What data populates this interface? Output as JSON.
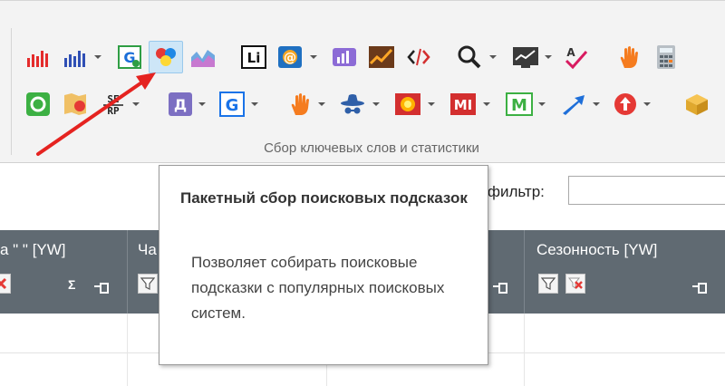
{
  "ribbon": {
    "group_label": "Сбор ключевых слов и статистики",
    "row1": [
      {
        "icon": "bar-chart-red-icon"
      },
      {
        "icon": "bar-chart-blue-icon"
      },
      {
        "icon": "google-stats-icon"
      },
      {
        "icon": "batch-suggestions-icon"
      },
      {
        "icon": "area-chart-icon"
      },
      {
        "icon": "linkedin-icon",
        "text": "Li"
      },
      {
        "icon": "at-sign-icon",
        "text": "@"
      },
      {
        "icon": "purple-chart-icon"
      },
      {
        "icon": "trend-chart-icon"
      },
      {
        "icon": "code-tag-icon"
      },
      {
        "icon": "search-icon"
      },
      {
        "icon": "monitor-chart-icon"
      },
      {
        "icon": "spellcheck-icon",
        "text": "A"
      },
      {
        "icon": "hand-stop-icon"
      },
      {
        "icon": "calculator-icon"
      }
    ],
    "row2": [
      {
        "icon": "green-ring-icon"
      },
      {
        "icon": "map-pin-icon"
      },
      {
        "icon": "serp-icon",
        "text": "SE RP"
      },
      {
        "icon": "letter-d-icon",
        "text": "Д"
      },
      {
        "icon": "google-g-icon",
        "text": "G"
      },
      {
        "icon": "hand-stop-icon"
      },
      {
        "icon": "spy-hat-icon"
      },
      {
        "icon": "sun-burst-icon"
      },
      {
        "icon": "mi-logo-icon",
        "text": "MI"
      },
      {
        "icon": "letter-m-icon",
        "text": "M"
      },
      {
        "icon": "arrow-export-icon"
      },
      {
        "icon": "red-circle-icon"
      },
      {
        "icon": "box-package-icon"
      }
    ]
  },
  "filter": {
    "label": "фильтр:",
    "value": ""
  },
  "grid": {
    "columns": [
      {
        "title": "а \" \" [YW]"
      },
      {
        "title": "Ча"
      },
      {
        "title": ""
      },
      {
        "title": "Сезонность [YW]"
      }
    ],
    "sum_symbol": "Σ"
  },
  "tooltip": {
    "title": "Пакетный сбор поисковых подсказок",
    "body": "Позволяет собирать поисковые подсказки с популярных поисковых систем."
  },
  "colors": {
    "header_bg": "#606a72",
    "ribbon_bg": "#f3f3f3",
    "arrow": "#e52320",
    "highlight": "#cde6f7"
  }
}
